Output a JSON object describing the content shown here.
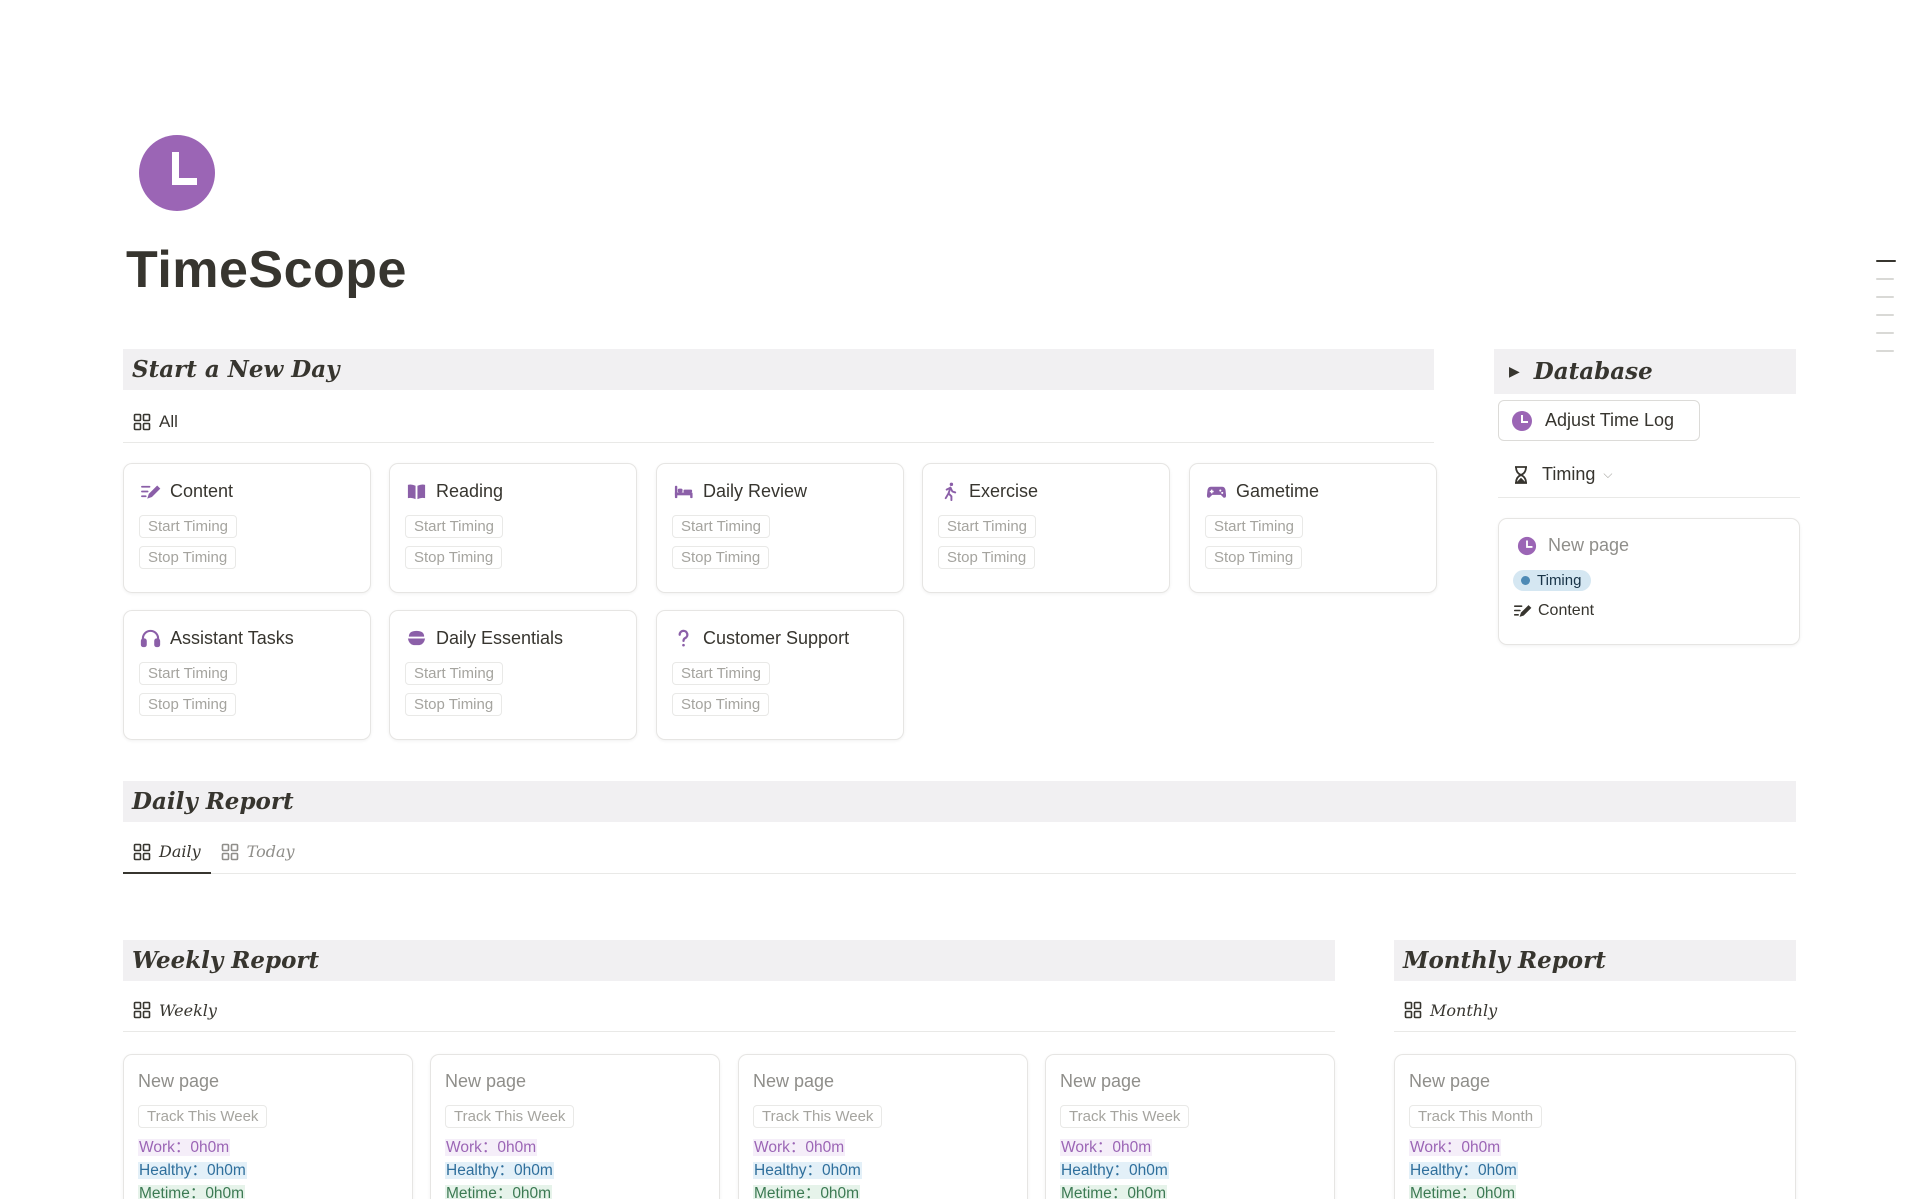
{
  "page": {
    "title": "TimeScope",
    "icon": "clock-icon",
    "accent": "#9b65b5"
  },
  "start_day": {
    "heading": "Start a New Day",
    "view": {
      "label": "All",
      "icon": "gallery-icon"
    },
    "cards": [
      {
        "title": "Content",
        "icon": "pen-lines-icon",
        "start": "Start Timing",
        "stop": "Stop Timing"
      },
      {
        "title": "Reading",
        "icon": "book-icon",
        "start": "Start Timing",
        "stop": "Stop Timing"
      },
      {
        "title": "Daily Review",
        "icon": "bed-icon",
        "start": "Start Timing",
        "stop": "Stop Timing"
      },
      {
        "title": "Exercise",
        "icon": "runner-icon",
        "start": "Start Timing",
        "stop": "Stop Timing"
      },
      {
        "title": "Gametime",
        "icon": "gamepad-icon",
        "start": "Start Timing",
        "stop": "Stop Timing"
      },
      {
        "title": "Assistant Tasks",
        "icon": "headphones-icon",
        "start": "Start Timing",
        "stop": "Stop Timing"
      },
      {
        "title": "Daily Essentials",
        "icon": "bowl-icon",
        "start": "Start Timing",
        "stop": "Stop Timing"
      },
      {
        "title": "Customer Support",
        "icon": "question-icon",
        "start": "Start Timing",
        "stop": "Stop Timing"
      }
    ]
  },
  "database": {
    "heading": "Database",
    "adjust_button": "Adjust Time Log",
    "view": {
      "label": "Timing",
      "icon": "hourglass-icon"
    },
    "card": {
      "title": "New page",
      "tag": "Timing",
      "category": "Content"
    }
  },
  "daily_report": {
    "heading": "Daily Report",
    "tabs": [
      {
        "label": "Daily",
        "active": true
      },
      {
        "label": "Today",
        "active": false
      }
    ]
  },
  "weekly_report": {
    "heading": "Weekly Report",
    "view": {
      "label": "Weekly"
    },
    "cards": [
      {
        "title": "New page",
        "track": "Track This Week",
        "work": "Work：0h0m",
        "healthy": "Healthy：0h0m",
        "metime": "Metime：0h0m"
      },
      {
        "title": "New page",
        "track": "Track This Week",
        "work": "Work：0h0m",
        "healthy": "Healthy：0h0m",
        "metime": "Metime：0h0m"
      },
      {
        "title": "New page",
        "track": "Track This Week",
        "work": "Work：0h0m",
        "healthy": "Healthy：0h0m",
        "metime": "Metime：0h0m"
      },
      {
        "title": "New page",
        "track": "Track This Week",
        "work": "Work：0h0m",
        "healthy": "Healthy：0h0m",
        "metime": "Metime：0h0m"
      }
    ]
  },
  "monthly_report": {
    "heading": "Monthly Report",
    "view": {
      "label": "Monthly"
    },
    "card": {
      "title": "New page",
      "track": "Track This Month",
      "work": "Work：0h0m",
      "healthy": "Healthy：0h0m",
      "metime": "Metime：0h0m"
    }
  }
}
